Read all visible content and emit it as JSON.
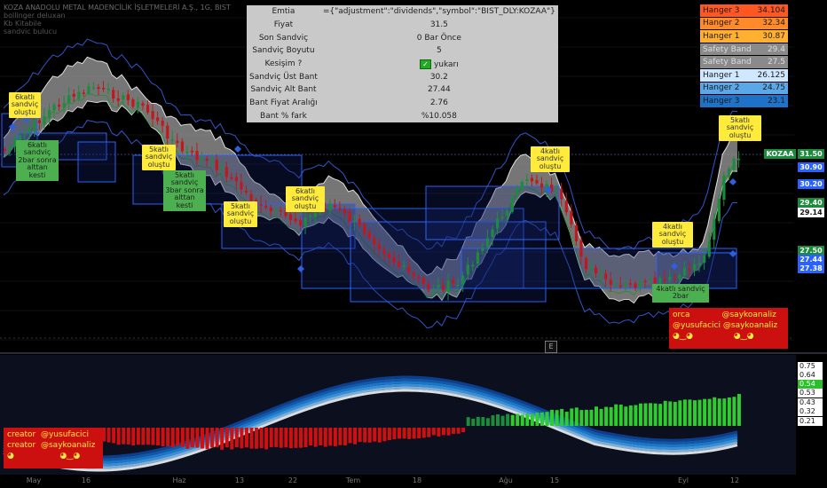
{
  "legend": {
    "title": "KOZA ANADOLU METAL MADENCİLİK İŞLETMELERİ A.Ş., 1G, BIST",
    "lines": [
      "bollinger deluxan",
      "Kb Kitabile",
      "sandvic bulucu"
    ]
  },
  "info_table": {
    "rows": [
      {
        "key": "Emtia",
        "value": "={\"adjustment\":\"dividends\",\"symbol\":\"BIST_DLY:KOZAA\"}"
      },
      {
        "key": "Fiyat",
        "value": "31.5"
      },
      {
        "key": "Son Sandviç",
        "value": "0 Bar Önce"
      },
      {
        "key": "Sandviç Boyutu",
        "value": "5"
      },
      {
        "key": "Kesişim ?",
        "value": "yukarı",
        "check": true
      },
      {
        "key": "Sandviç Üst Bant",
        "value": "30.2"
      },
      {
        "key": "Sandviç Alt Bant",
        "value": "27.44"
      },
      {
        "key": "Bant Fiyat Aralığı",
        "value": "2.76"
      },
      {
        "key": "Bant % fark",
        "value": "%10.058"
      }
    ]
  },
  "levels": [
    {
      "name": "Hanger 3",
      "value": "34.104",
      "bg": "#ff5722",
      "fg": "#1a1a1a"
    },
    {
      "name": "Hanger 2",
      "value": "32.34",
      "bg": "#ff8a2a",
      "fg": "#1a1a1a"
    },
    {
      "name": "Hanger 1",
      "value": "30.87",
      "bg": "#ffb030",
      "fg": "#1a1a1a"
    },
    {
      "name": "Safety Band",
      "value": "29.4",
      "bg": "#8a8a8a",
      "fg": "#dddddd"
    },
    {
      "name": "Safety Band",
      "value": "27.5",
      "bg": "#8a8a8a",
      "fg": "#dddddd"
    },
    {
      "name": "Hanger 1",
      "value": "26.125",
      "bg": "#cfe8ff",
      "fg": "#1a1a1a"
    },
    {
      "name": "Hanger 2",
      "value": "24.75",
      "bg": "#5aa8e8",
      "fg": "#1a1a1a"
    },
    {
      "name": "Hanger 3",
      "value": "23.1",
      "bg": "#1e73c8",
      "fg": "#1a1a1a"
    }
  ],
  "notes": {
    "yellow": [
      "6katlı sandviç oluştu",
      "5katlı sandviç oluştu",
      "5katlı sandviç oluştu",
      "6katlı sandviç oluştu",
      "4katlı sandviç oluştu",
      "4katlı sandviç oluştu",
      "5katlı sandviç oluştu"
    ],
    "green": [
      "6katlı sandviç 2bar sonra alttan kesti",
      "5katlı sandviç 3bar sonra alttan kesti",
      "4katlı sandviç 2bar"
    ]
  },
  "price_tags": {
    "symbol": "KOZAA",
    "price": "31.50",
    "upper1": "30.90",
    "upper2": "30.20",
    "mid_a": "29.40",
    "mid_b": "29.14",
    "low_a": "27.50",
    "low_b": "27.44",
    "low_c": "27.38"
  },
  "credits_top": [
    "orca",
    "@saykoanaliz",
    "@yusufacici",
    "@saykoanaliz"
  ],
  "credits_bottom": [
    {
      "label": "creator",
      "handle": "@yusufacici"
    },
    {
      "label": "creator",
      "handle": "@saykoanaliz"
    }
  ],
  "osc_axis": [
    "0.75",
    "0.64",
    "0.54",
    "0.53",
    "0.43",
    "0.32",
    "0.21"
  ],
  "x_axis": [
    "May",
    "16",
    "Haz",
    "13",
    "22",
    "Tem",
    "18",
    "Ağu",
    "15",
    "Eyl",
    "12"
  ],
  "e_button": "E",
  "colors": {
    "up": "#1b8c3c",
    "down": "#c2181b",
    "cloud": "#9e9e9e",
    "box": "#2962ff",
    "accent_green": "#4caf50"
  },
  "icons": [
    "check-icon",
    "diamond-marker-icon"
  ]
}
